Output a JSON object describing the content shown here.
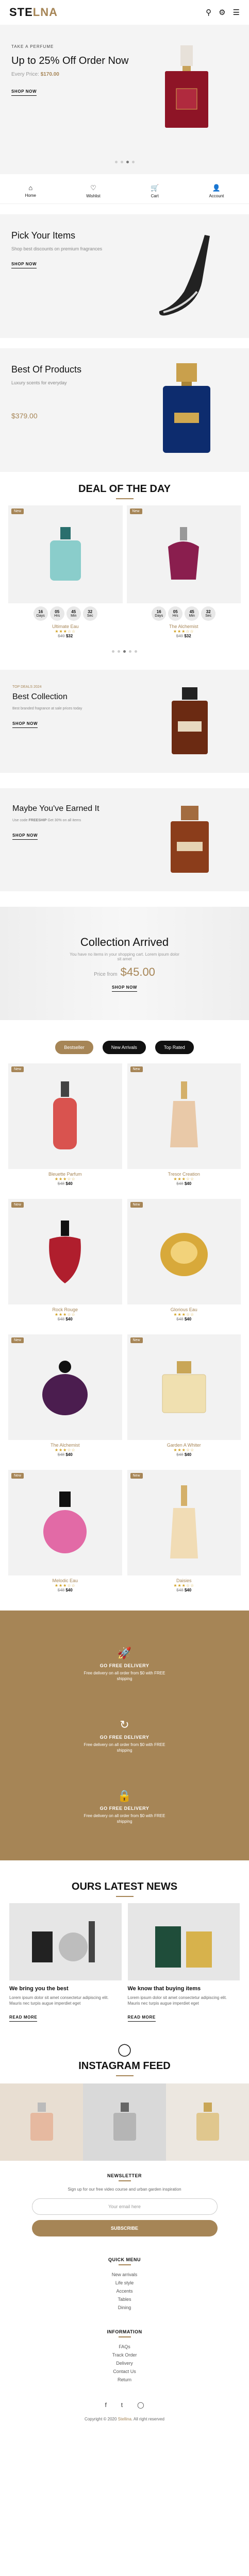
{
  "header": {
    "logo_main": "STE",
    "logo_accent": "LNA"
  },
  "hero": {
    "tag": "TAKE A PERFUME",
    "title": "Up to 25% Off Order Now",
    "price_label": "Every Price:",
    "price": "$170.00",
    "cta": "SHOP NOW"
  },
  "nav": [
    {
      "icon": "home-icon",
      "glyph": "⌂",
      "label": "Home"
    },
    {
      "icon": "heart-icon",
      "glyph": "♡",
      "label": "Wishlist"
    },
    {
      "icon": "cart-icon",
      "glyph": "🛒",
      "label": "Cart"
    },
    {
      "icon": "user-icon",
      "glyph": "👤",
      "label": "Account"
    }
  ],
  "promo1": {
    "title": "Pick Your Items",
    "desc": "Shop best discounts on premium fragrances",
    "cta": "SHOP NOW"
  },
  "promo2": {
    "title": "Best Of Products",
    "desc": "Luxury scents for everyday",
    "price": "$379.00"
  },
  "deal": {
    "title": "DEAL OF THE DAY",
    "badge": "New",
    "countdown_units": [
      "Days",
      "Hrs",
      "Min",
      "Sec"
    ],
    "countdown_values": [
      "16",
      "05",
      "45",
      "32"
    ],
    "items": [
      {
        "name": "Ultimate Eau",
        "stars": "★★★☆☆",
        "old": "$49",
        "price": "$32"
      },
      {
        "name": "The Alchemist",
        "stars": "★★★☆☆",
        "old": "$49",
        "price": "$32"
      }
    ]
  },
  "banner1": {
    "tag": "TOP DEALS 2024",
    "title": "Best Collection",
    "desc": "Best branded fragrance at sale prices today",
    "cta": "SHOP NOW"
  },
  "banner2": {
    "title": "Maybe You've Earned It",
    "desc_label": "Use code",
    "code": "FREESHIP",
    "desc_tail": "Get 30% on all items",
    "cta": "SHOP NOW"
  },
  "collection": {
    "title": "Collection Arrived",
    "desc": "You have no items in your shopping cart. Lorem ipsum dolor sit amet",
    "price_label": "Price from",
    "price": "$45.00",
    "cta": "SHOP NOW"
  },
  "tabs": [
    "Bestseller",
    "New Arrivals",
    "Top Rated"
  ],
  "products": [
    {
      "name": "Bleuette Parfum",
      "stars": "★★★☆☆",
      "old": "$48",
      "price": "$40",
      "color": "#d9534f"
    },
    {
      "name": "Tresor Creation",
      "stars": "★★★☆☆",
      "old": "$48",
      "price": "$40",
      "color": "#e9c9a8"
    },
    {
      "name": "Rock Rouge",
      "stars": "★★★☆☆",
      "old": "$48",
      "price": "$40",
      "color": "#b01e2d"
    },
    {
      "name": "Glorious Eau",
      "stars": "★★★☆☆",
      "old": "$48",
      "price": "$40",
      "color": "#d8a93a"
    },
    {
      "name": "The Alchemist",
      "stars": "★★★☆☆",
      "old": "$48",
      "price": "$40",
      "color": "#4b1d4f"
    },
    {
      "name": "Garden A Whiter",
      "stars": "★★★☆☆",
      "old": "$48",
      "price": "$40",
      "color": "#f0e0b0"
    },
    {
      "name": "Melodic Eau",
      "stars": "★★★☆☆",
      "old": "$48",
      "price": "$40",
      "color": "#e26aa6"
    },
    {
      "name": "Daisies",
      "stars": "★★★☆☆",
      "old": "$48",
      "price": "$40",
      "color": "#f1dcb5"
    }
  ],
  "services": [
    {
      "icon": "rocket-icon",
      "glyph": "🚀",
      "title": "GO FREE DELIVERY",
      "desc": "Free delivery on all order from $0 with FREE shipping"
    },
    {
      "icon": "refresh-icon",
      "glyph": "↻",
      "title": "GO FREE DELIVERY",
      "desc": "Free delivery on all order from $0 with FREE shipping"
    },
    {
      "icon": "lock-icon",
      "glyph": "🔒",
      "title": "GO FREE DELIVERY",
      "desc": "Free delivery on all order from $0 with FREE shipping"
    }
  ],
  "news": {
    "title": "OURS LATEST NEWS",
    "items": [
      {
        "title": "We bring you the best",
        "desc": "Lorem ipsum dolor sit amet consectetur adipiscing elit. Mauris nec turpis augue imperdiet eget",
        "cta": "READ MORE"
      },
      {
        "title": "We know that buying items",
        "desc": "Lorem ipsum dolor sit amet consectetur adipiscing elit. Mauris nec turpis augue imperdiet eget",
        "cta": "READ MORE"
      }
    ]
  },
  "instagram": {
    "title": "INSTAGRAM FEED"
  },
  "newsletter": {
    "title": "NEWSLETTER",
    "desc": "Sign up for our free video course and urban garden inspiration",
    "placeholder": "Your email here",
    "button": "SUBSCRIBE"
  },
  "quick_menu": {
    "title": "QUICK MENU",
    "links": [
      "New arrivals",
      "Life style",
      "Accents",
      "Tables",
      "Dining"
    ]
  },
  "information": {
    "title": "INFORMATION",
    "links": [
      "FAQs",
      "Track Order",
      "Delivery",
      "Contact Us",
      "Return"
    ]
  },
  "footer": {
    "copy_pre": "Copyright © 2020",
    "brand": "Stellina",
    "copy_post": ". All right reserved"
  }
}
